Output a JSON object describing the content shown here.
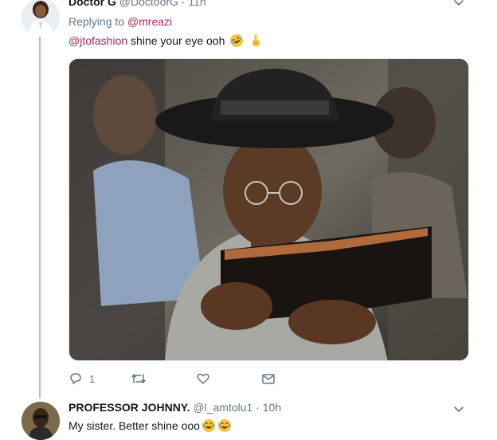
{
  "tweet1": {
    "name": "Doctor G",
    "handle": "@DoctoorG",
    "separator": " · ",
    "time": "11h",
    "replying_label": "Replying to ",
    "replying_handle": "@mreazi",
    "mention": "@jtofashion",
    "text": " shine your eye ooh",
    "emojis": [
      "rolling-laughing-emoji",
      "pointing-up-emoji"
    ],
    "actions": {
      "reply_count": "1"
    }
  },
  "tweet2": {
    "name": "PROFESSOR JOHNNY.",
    "handle": "@l_amtolu1",
    "separator": " · ",
    "time": "10h",
    "text": "My sister. Better shine ooo",
    "emojis": [
      "tears-of-joy-emoji",
      "tears-of-joy-emoji"
    ]
  },
  "colors": {
    "link": "#b0285a",
    "thread_line": "#e7a7bd",
    "muted": "#657786",
    "text": "#14171a"
  }
}
